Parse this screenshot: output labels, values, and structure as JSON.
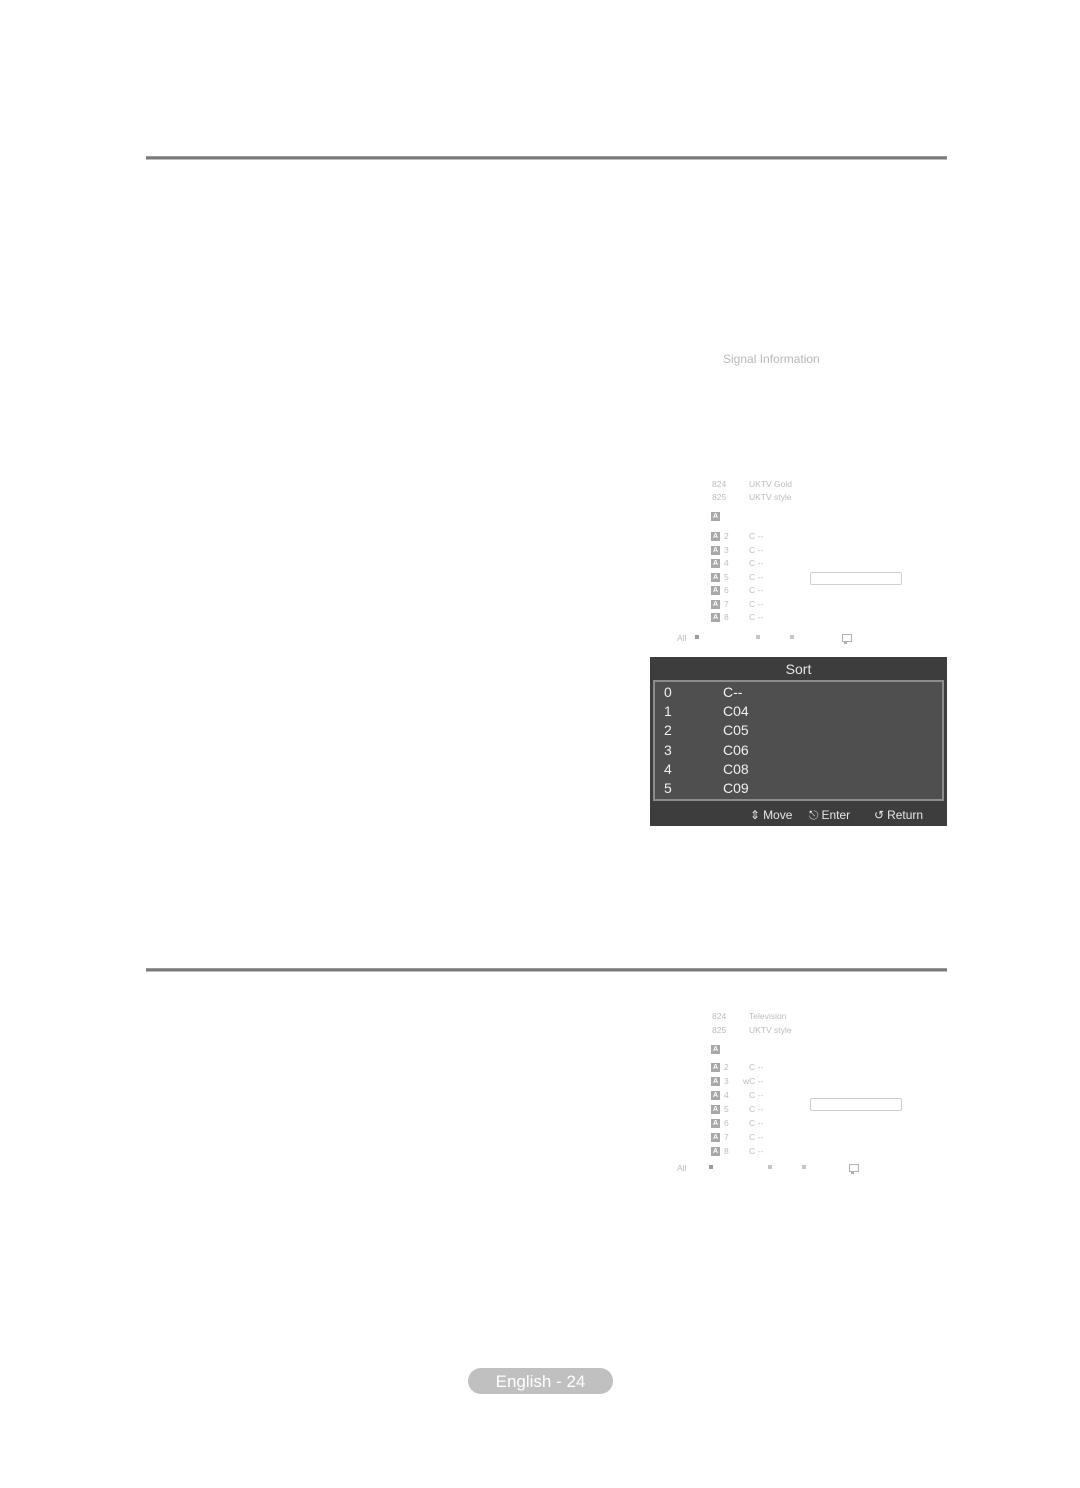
{
  "screen1": {
    "signal_label": "Signal Information",
    "top_channels": [
      {
        "number": "824",
        "name": "UKTV Gold"
      },
      {
        "number": "825",
        "name": "UKTV style"
      }
    ],
    "antenna_label": "A",
    "analog_channels": [
      {
        "number": "2",
        "name": "C --"
      },
      {
        "number": "3",
        "name": "C --"
      },
      {
        "number": "4",
        "name": "C --"
      },
      {
        "number": "5",
        "name": "C --"
      },
      {
        "number": "6",
        "name": "C --"
      },
      {
        "number": "7",
        "name": "C --"
      },
      {
        "number": "8",
        "name": "C --"
      }
    ],
    "footer_label": "All"
  },
  "sort_menu": {
    "title": "Sort",
    "rows": [
      {
        "num": "0",
        "ch": "C--"
      },
      {
        "num": "1",
        "ch": "C04"
      },
      {
        "num": "2",
        "ch": "C05"
      },
      {
        "num": "3",
        "ch": "C06"
      },
      {
        "num": "4",
        "ch": "C08"
      },
      {
        "num": "5",
        "ch": "C09"
      }
    ],
    "footer": {
      "move_icon": "up-down-arrows-icon",
      "move": "Move",
      "enter_icon": "enter-icon",
      "enter": "Enter",
      "return_icon": "return-icon",
      "return": "Return"
    }
  },
  "screen2": {
    "top_channels": [
      {
        "number": "824",
        "name": "Television"
      },
      {
        "number": "825",
        "name": "UKTV style"
      }
    ],
    "antenna_label": "A",
    "analog_channels": [
      {
        "number": "2",
        "name": "C --"
      },
      {
        "number": "3",
        "name": "wC --"
      },
      {
        "number": "4",
        "name": "C --"
      },
      {
        "number": "5",
        "name": "C --"
      },
      {
        "number": "6",
        "name": "C --"
      },
      {
        "number": "7",
        "name": "C --"
      },
      {
        "number": "8",
        "name": "C --"
      }
    ],
    "footer_label": "All"
  },
  "page_footer": "English - 24"
}
